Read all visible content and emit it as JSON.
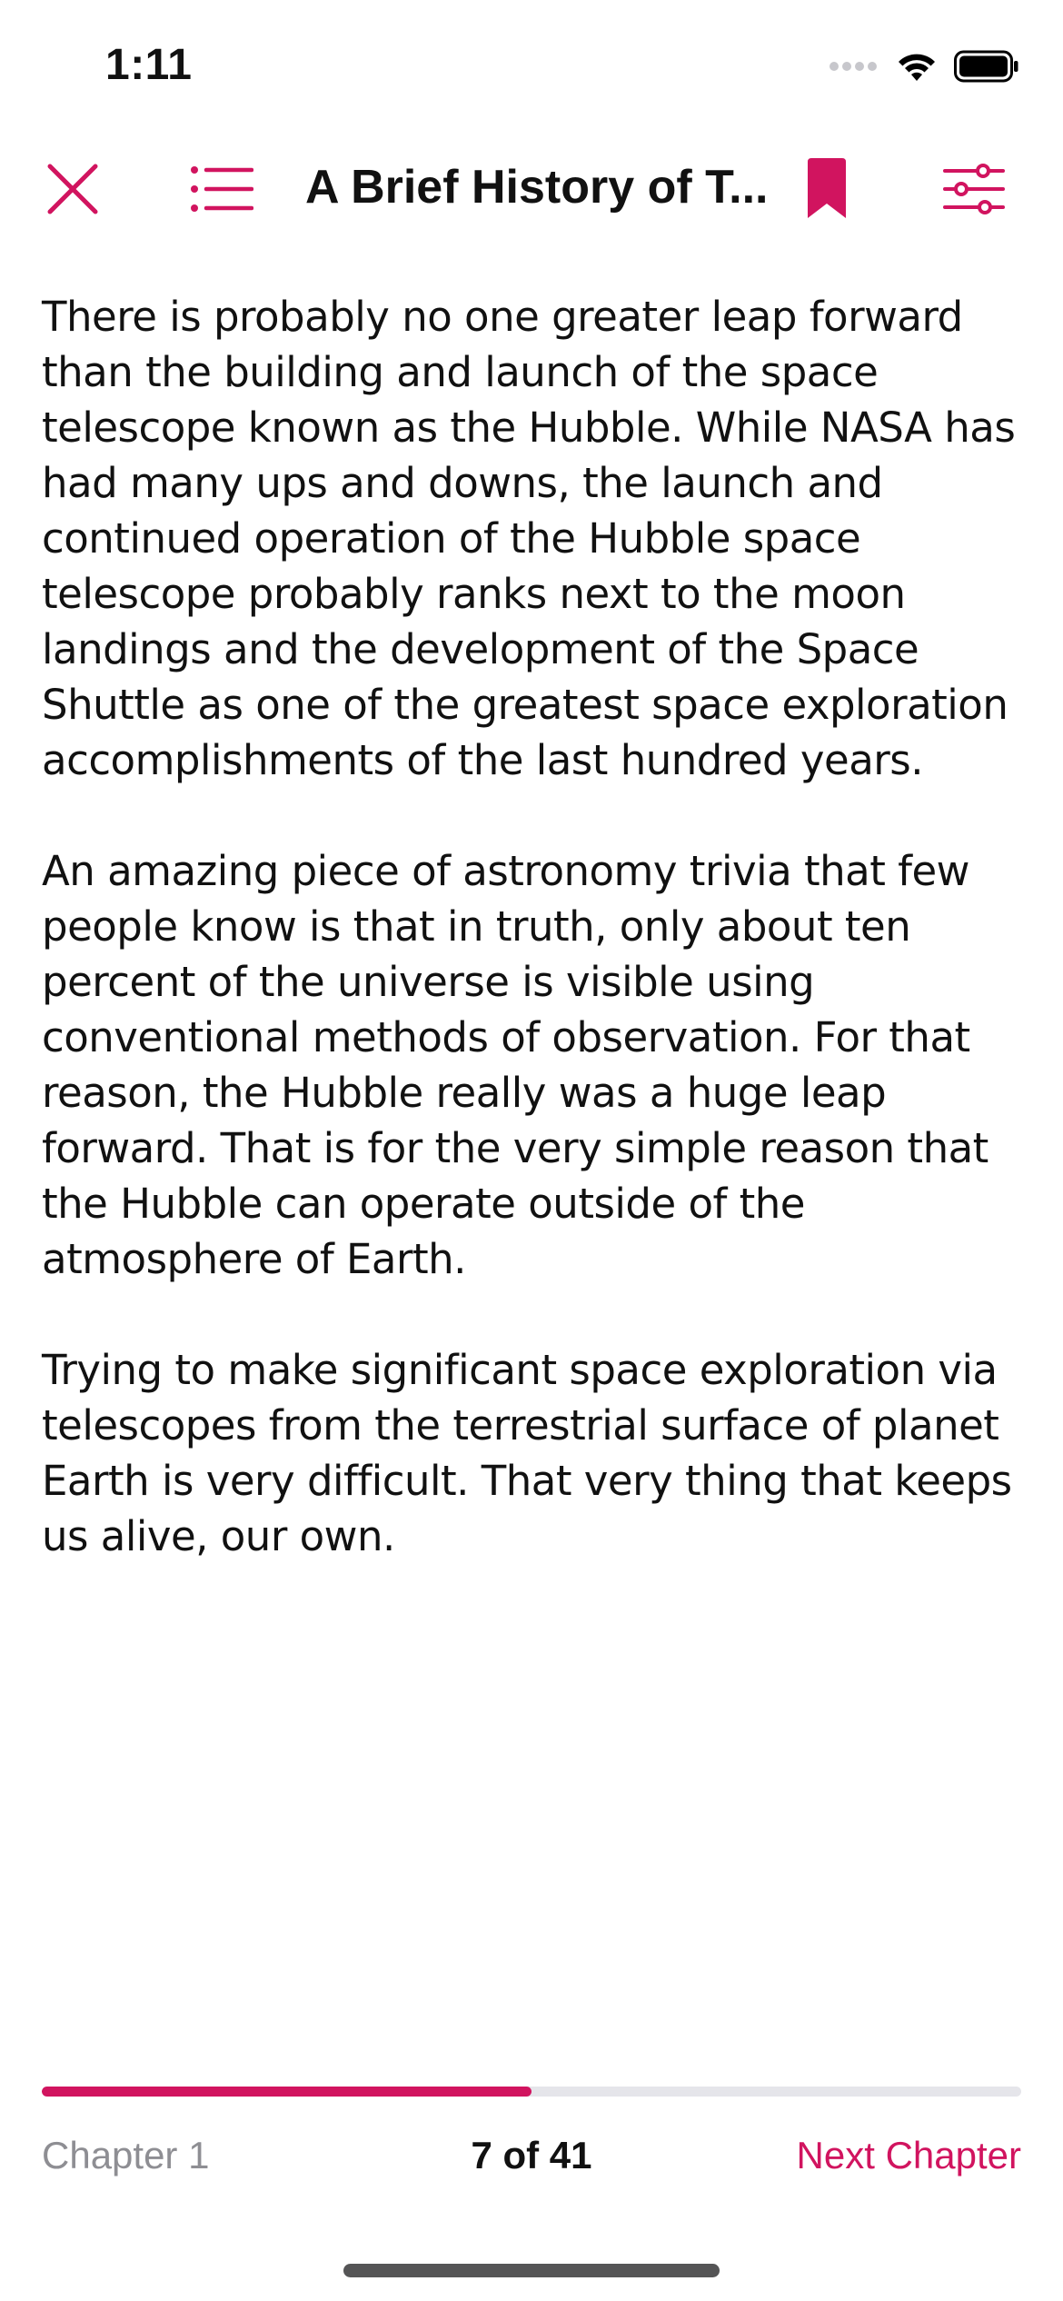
{
  "status_bar": {
    "time": "1:11",
    "icons": [
      "cellular-dots-icon",
      "wifi-icon",
      "battery-icon"
    ]
  },
  "nav": {
    "title": "A Brief History of T...",
    "close_icon": "close-icon",
    "contents_icon": "list-icon",
    "bookmark_icon": "bookmark-icon",
    "settings_icon": "sliders-icon",
    "accent_color": "#d1145f"
  },
  "content": {
    "paragraphs": [
      "There is probably no one greater leap forward than the building and launch of the space telescope known as the Hubble. While NASA has had many ups and downs, the launch and continued operation of the Hubble space telescope probably ranks next to the moon landings and the development of the Space Shuttle as one of the greatest space exploration accomplishments of the last hundred years.",
      "An amazing piece of astronomy trivia that few people know is that in truth, only about ten percent of the universe is visible using conventional methods of observation. For that reason, the Hubble really was a huge leap forward. That is for the very simple reason that the Hubble can operate outside of the atmosphere of Earth.",
      "Trying to make significant space exploration via telescopes from the terrestrial surface of planet Earth is very difficult. That very thing that keeps us alive, our own."
    ]
  },
  "progress": {
    "fraction": 0.5
  },
  "footer": {
    "chapter_label": "Chapter 1",
    "page_indicator": "7 of 41",
    "next_label": "Next Chapter"
  }
}
